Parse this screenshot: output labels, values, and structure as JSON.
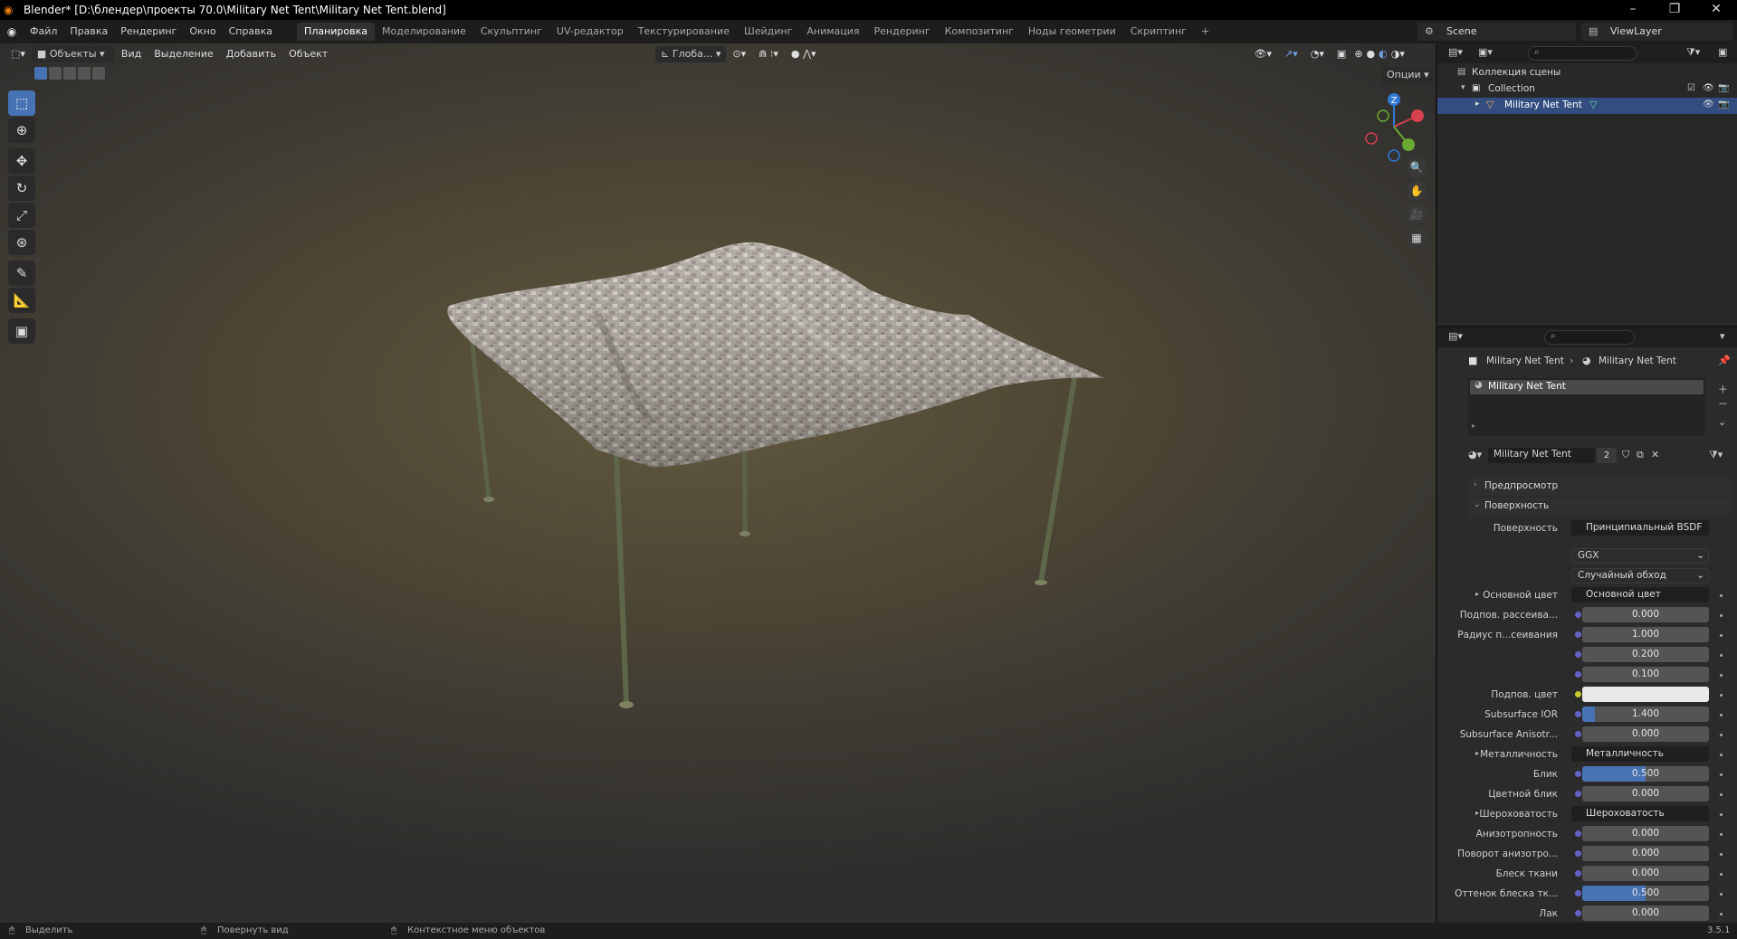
{
  "titlebar": {
    "title": "Blender* [D:\\блендер\\проекты 70.0\\Military Net Tent\\Military Net Tent.blend]"
  },
  "menu": {
    "items": [
      "Файл",
      "Правка",
      "Рендеринг",
      "Окно",
      "Справка"
    ],
    "workspaces": [
      "Планировка",
      "Моделирование",
      "Скульптинг",
      "UV-редактор",
      "Текстурирование",
      "Шейдинг",
      "Анимация",
      "Рендеринг",
      "Композитинг",
      "Ноды геометрии",
      "Скриптинг"
    ],
    "active_workspace": "Планировка",
    "add_tab": "+",
    "scene": "Scene",
    "view_layer": "ViewLayer"
  },
  "viewport": {
    "mode": "Объекты",
    "menus": [
      "Вид",
      "Выделение",
      "Добавить",
      "Объект"
    ],
    "orientation": "Глоба...",
    "options": "Опции",
    "gizmo": {
      "z": "Z"
    }
  },
  "outliner": {
    "scene_collection": "Коллекция сцены",
    "collection": "Collection",
    "object": "Military Net Tent"
  },
  "properties": {
    "breadcrumb": [
      "Military Net Tent",
      "Military Net Tent"
    ],
    "slot": "Military Net Tent",
    "material": "Military Net Tent",
    "users": "2",
    "sections": {
      "preview": "Предпросмотр",
      "surface": "Поверхность"
    },
    "surface_label": "Поверхность",
    "surface_value": "Принципиальный BSDF",
    "distribution": "GGX",
    "subsurface_method": "Случайный обход",
    "rows": [
      {
        "label": "Основной цвет",
        "link": "Основной цвет",
        "expand": true
      },
      {
        "label": "Подпов. рассеива...",
        "value": "0.000",
        "fill": 0
      },
      {
        "label": "Радиус п...сеивания",
        "value": "1.000",
        "fill": 0
      },
      {
        "label": "",
        "value": "0.200",
        "fill": 0
      },
      {
        "label": "",
        "value": "0.100",
        "fill": 0
      },
      {
        "label": "Подпов. цвет",
        "color": "#e8e8e8"
      },
      {
        "label": "Subsurface IOR",
        "value": "1.400",
        "fill": 0.1
      },
      {
        "label": "Subsurface Anisotr...",
        "value": "0.000",
        "fill": 0
      },
      {
        "label": "Металличность",
        "link": "Металличность",
        "expand": true
      },
      {
        "label": "Блик",
        "value": "0.500",
        "fill": 0.5
      },
      {
        "label": "Цветной блик",
        "value": "0.000",
        "fill": 0
      },
      {
        "label": "Шероховатость",
        "link": "Шероховатость",
        "expand": true
      },
      {
        "label": "Анизотропность",
        "value": "0.000",
        "fill": 0
      },
      {
        "label": "Поворот анизотро...",
        "value": "0.000",
        "fill": 0
      },
      {
        "label": "Блеск ткани",
        "value": "0.000",
        "fill": 0
      },
      {
        "label": "Оттенок блеска тк...",
        "value": "0.500",
        "fill": 0.5
      },
      {
        "label": "Лак",
        "value": "0.000",
        "fill": 0
      }
    ]
  },
  "statusbar": {
    "select": "Выделить",
    "rotate": "Повернуть вид",
    "context": "Контекстное меню объектов",
    "version": "3.5.1"
  }
}
